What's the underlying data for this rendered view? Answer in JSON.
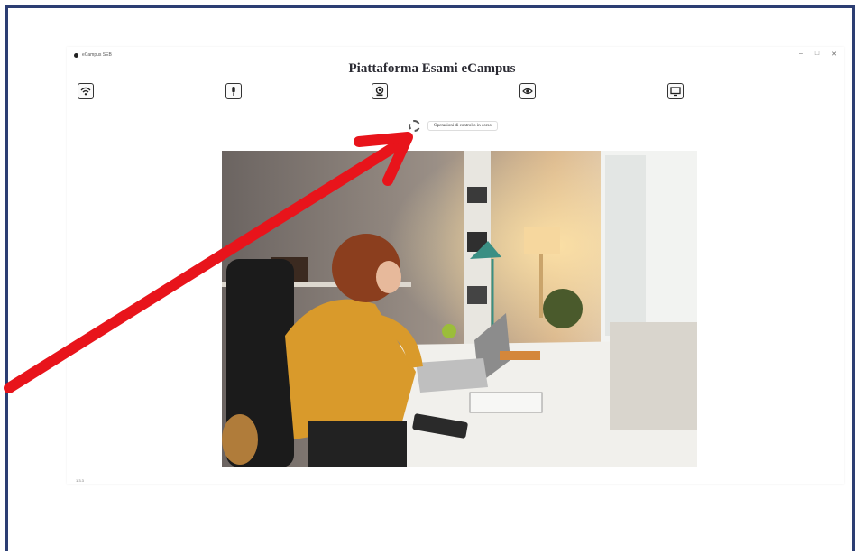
{
  "window": {
    "app_name": "eCampus SEB",
    "minimize": "–",
    "maximize": "□",
    "close": "✕"
  },
  "header": {
    "title": "Piattaforma Esami eCampus"
  },
  "checks": [
    {
      "icon": "wifi-icon"
    },
    {
      "icon": "microphone-icon"
    },
    {
      "icon": "webcam-icon"
    },
    {
      "icon": "eye-icon"
    },
    {
      "icon": "monitor-icon"
    }
  ],
  "status": {
    "text": "Operazioni di controllo in corso"
  },
  "footer": {
    "version": "1.3.3"
  },
  "colors": {
    "frame_border": "#2c3e73",
    "arrow": "#e8141b",
    "title": "#2b2b33"
  }
}
